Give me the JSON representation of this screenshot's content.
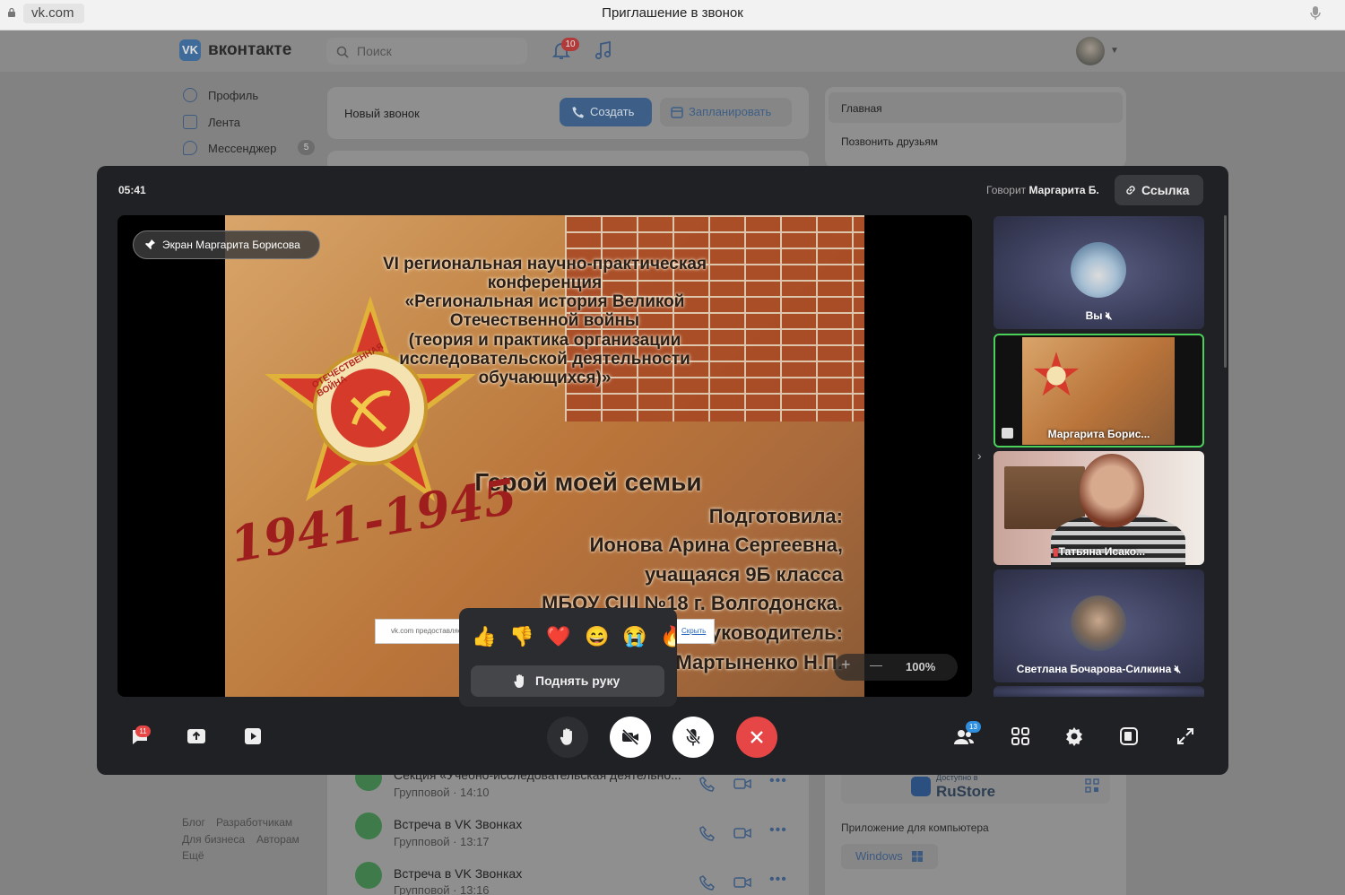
{
  "browser": {
    "url": "vk.com",
    "window_title": "Приглашение в звонок"
  },
  "header": {
    "logo_text": "вконтакте",
    "search_placeholder": "Поиск",
    "notifications_count": "10"
  },
  "left_nav": {
    "items": [
      {
        "label": "Профиль",
        "icon": "profile-icon"
      },
      {
        "label": "Лента",
        "icon": "feed-icon"
      },
      {
        "label": "Мессенджер",
        "icon": "messenger-icon",
        "badge": "5"
      }
    ],
    "footer_links": [
      "Блог",
      "Разработчикам",
      "Для бизнеса",
      "Авторам",
      "Ещё"
    ]
  },
  "new_call": {
    "title": "Новый звонок",
    "create_label": "Создать",
    "schedule_label": "Запланировать"
  },
  "right_menu": {
    "main": "Главная",
    "call_friends": "Позвонить друзьям"
  },
  "call_list": [
    {
      "title": "Секция «Учебно-исследовательская деятельно...",
      "sub": "Групповой · 14:10"
    },
    {
      "title": "Встреча в VK Звонках",
      "sub": "Групповой · 13:17"
    },
    {
      "title": "Встреча в VK Звонках",
      "sub": "Групповой · 13:16"
    }
  ],
  "apps": {
    "rustore_small": "Доступно в",
    "rustore_name": "RuStore",
    "desktop_label": "Приложение для компьютера",
    "windows_label": "Windows"
  },
  "call": {
    "timer": "05:41",
    "speaking_prefix": "Говорит",
    "speaking_name": "Маргарита Б.",
    "link_label": "Ссылка",
    "screen_label": "Экран Маргарита Борисова",
    "zoom": "100%",
    "chat_badge": "11",
    "participants_badge": "13"
  },
  "slide": {
    "lines": [
      "VI региональная научно-практическая",
      "конференция",
      "«Региональная история Великой",
      "Отечественной войны",
      "(теория и практика организации",
      "исследовательской деятельности",
      "обучающихся)»"
    ],
    "title": "Герой моей семьи",
    "author_lines": [
      "Подготовила:",
      "Ионова Арина Сергеевна,",
      "учащаяся 9Б класса",
      "МБОУ СШ №18 г. Волгодонска.",
      "Руководитель:",
      "Мартыненко Н.П."
    ],
    "years": "1941-1945",
    "badge_text": "ОТЕЧЕСТВЕННАЯ ВОЙНА"
  },
  "notification": {
    "text": "vk.com предоставляет доступ к вашему экрану",
    "hide": "Скрыть"
  },
  "reactions": {
    "emojis": [
      "👍",
      "👎",
      "❤️",
      "😄",
      "😭",
      "🔥"
    ],
    "raise_hand": "Поднять руку"
  },
  "participants": [
    {
      "name": "Вы"
    },
    {
      "name": "Маргарита Борис..."
    },
    {
      "name": "Татьяна Исако..."
    },
    {
      "name": "Светлана Бочарова-Силкина"
    }
  ]
}
